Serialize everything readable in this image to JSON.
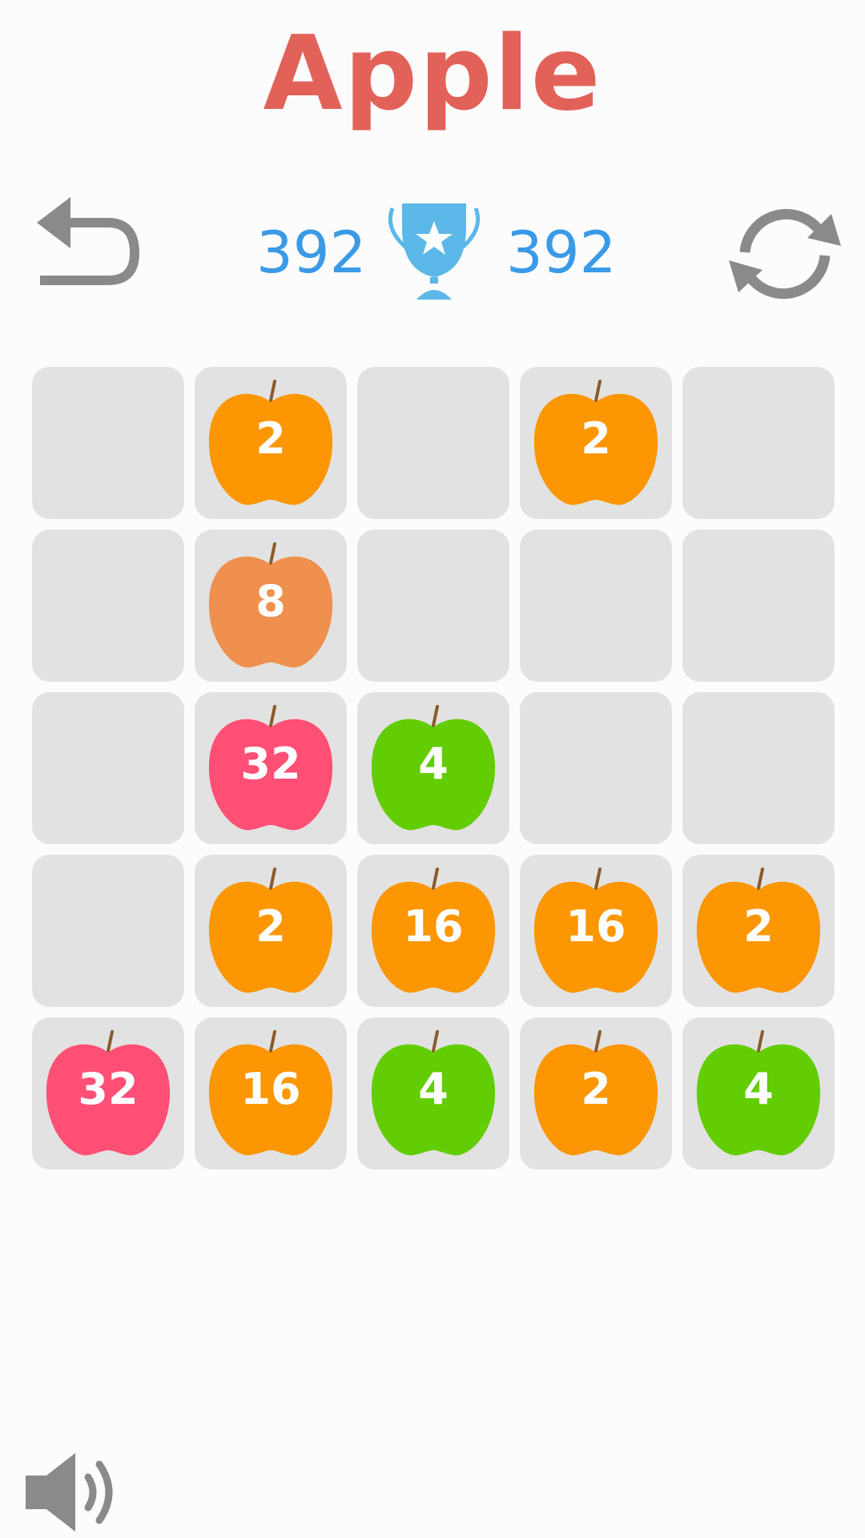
{
  "header": {
    "title": "Apple"
  },
  "toolbar": {
    "undo_icon": "undo-arrow-icon",
    "refresh_icon": "refresh-icon"
  },
  "scores": {
    "current": "392",
    "best": "392",
    "trophy_icon": "trophy-icon"
  },
  "board": {
    "size": 5,
    "tiles": [
      [
        null,
        2,
        null,
        2,
        null
      ],
      [
        null,
        8,
        null,
        null,
        null
      ],
      [
        null,
        32,
        4,
        null,
        null
      ],
      [
        null,
        2,
        16,
        16,
        2
      ],
      [
        32,
        16,
        4,
        2,
        4
      ]
    ]
  },
  "apple_colors": {
    "2": "#fc9602",
    "4": "#63cd03",
    "8": "#ef904e",
    "16": "#fc9602",
    "32": "#ff4f75"
  },
  "colors": {
    "title": "#e2625a",
    "score": "#3b9ae6",
    "trophy": "#5bb8e8",
    "cell": "#e2e2e2",
    "icon_gray": "#8a8a8a"
  },
  "footer": {
    "sound_icon": "speaker-icon"
  }
}
